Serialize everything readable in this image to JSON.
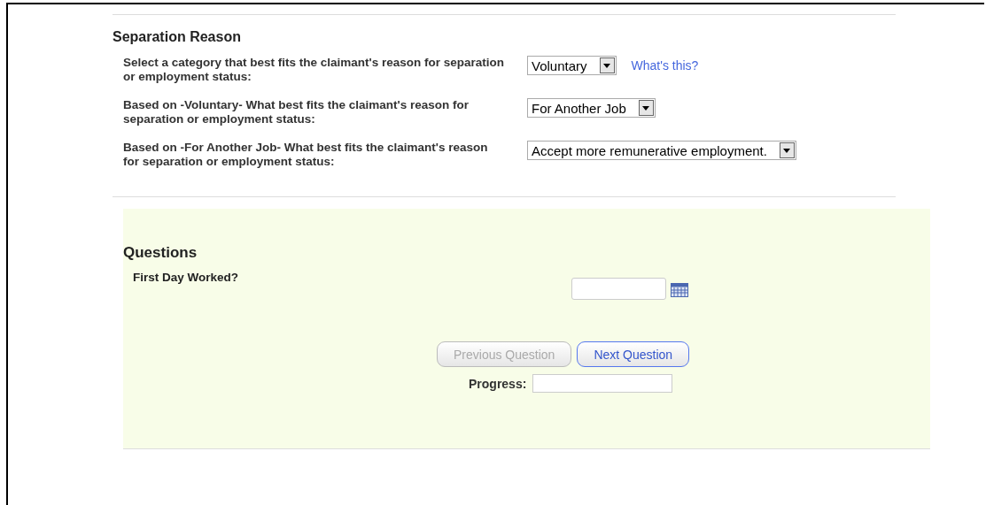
{
  "separation": {
    "heading": "Separation Reason",
    "rows": [
      {
        "label": "Select a category that best fits the claimant's reason for separation or employment status:",
        "value": "Voluntary",
        "link": "What's this?"
      },
      {
        "label": "Based on -Voluntary- What best fits the claimant's reason for separation or employment status:",
        "value": "For Another Job"
      },
      {
        "label": "Based on -For Another Job- What best fits the claimant's reason for separation or employment status:",
        "value": "Accept more remunerative employment."
      }
    ]
  },
  "questions": {
    "heading": "Questions",
    "question": "First Day Worked?",
    "buttons": [
      {
        "label": "Previous Question",
        "disabled": true
      },
      {
        "label": "Next Question",
        "disabled": false
      }
    ],
    "progress_label": "Progress:"
  }
}
